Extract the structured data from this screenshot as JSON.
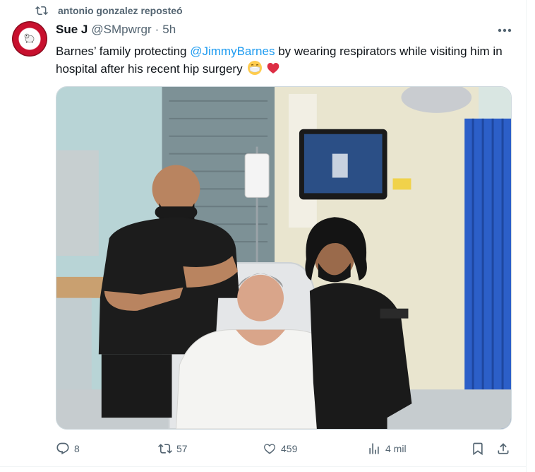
{
  "repost": {
    "text": "antonio gonzalez reposteó",
    "icon": "repost-icon"
  },
  "tweet": {
    "author_name": "Sue J",
    "author_handle": "@SMpwrgr",
    "separator": "·",
    "time": "5h",
    "text_before_mention": "Barnes’ family protecting ",
    "mention": "@JimmyBarnes",
    "text_after_mention": " by wearing respirators while visiting him in hospital after his recent hip surgery",
    "emojis": [
      "face-with-medical-mask",
      "red-heart"
    ]
  },
  "actions": {
    "replies": "8",
    "reposts": "57",
    "likes": "459",
    "views": "4 mil"
  },
  "colors": {
    "text": "#0f1419",
    "secondary": "#536471",
    "link": "#1d9bf0",
    "border": "#cfd9de",
    "heart": "#e0245e"
  }
}
